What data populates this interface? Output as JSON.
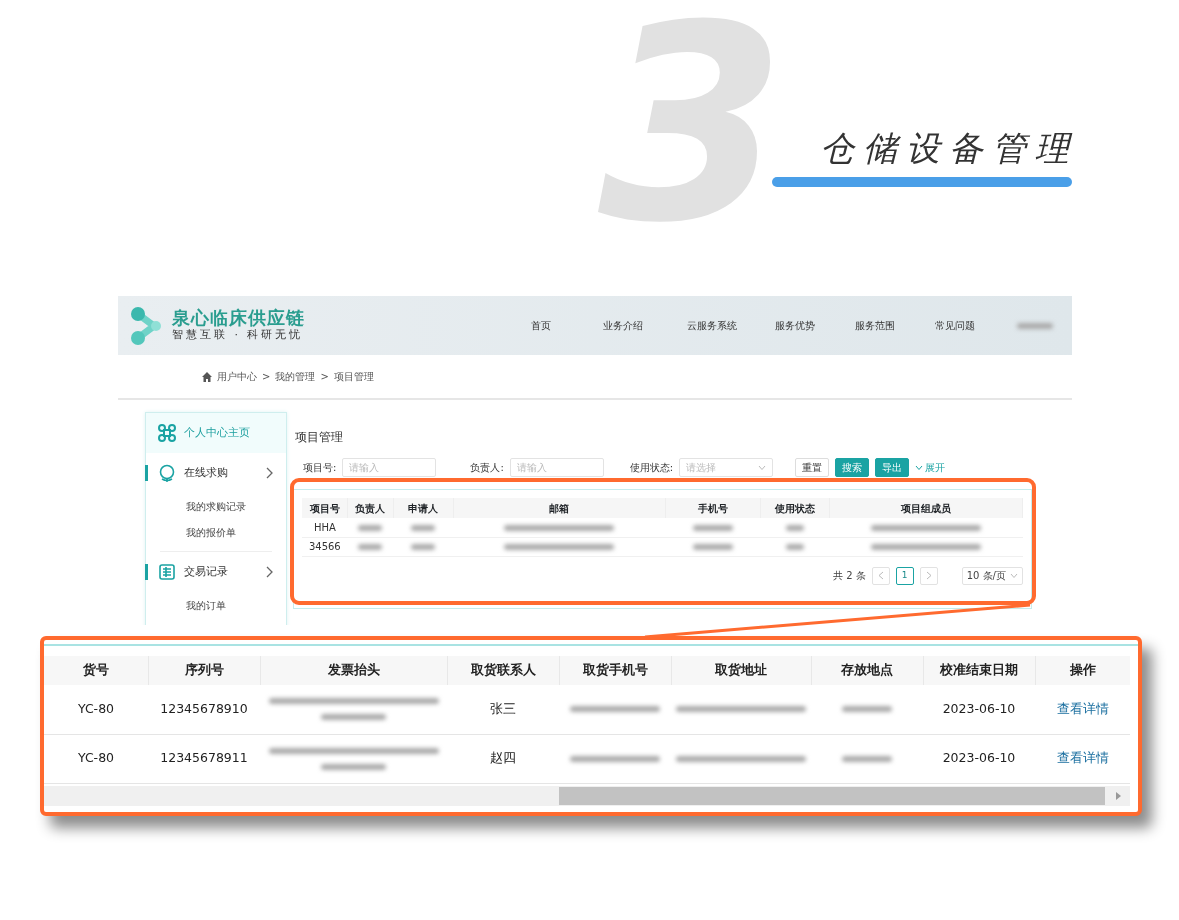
{
  "showcase": {
    "number": "3",
    "title": "仓储设备管理"
  },
  "app": {
    "logo": {
      "name": "泉心临床供应链",
      "slogan": "智慧互联 · 科研无忧"
    },
    "nav": [
      {
        "label": "首页"
      },
      {
        "label": "业务介绍"
      },
      {
        "label": "云服务系统"
      },
      {
        "label": "服务优势"
      },
      {
        "label": "服务范围"
      },
      {
        "label": "常见问题"
      },
      {
        "kind": "redacted"
      }
    ],
    "breadcrumb": [
      "用户中心",
      "我的管理",
      "项目管理"
    ],
    "breadcrumb_separator": ">",
    "sidebar": [
      {
        "label": "个人中心主页",
        "kind": "home",
        "selected": true
      },
      {
        "label": "在线求购",
        "kind": "group",
        "selected": false,
        "children": [
          {
            "label": "我的求购记录",
            "selected": false
          },
          {
            "label": "我的报价单",
            "selected": false
          }
        ]
      },
      {
        "label": "交易记录",
        "kind": "group",
        "selected": false,
        "children": [
          {
            "label": "我的订单",
            "selected": false
          }
        ]
      }
    ],
    "page_title": "项目管理",
    "filters": [
      {
        "label": "项目号:",
        "placeholder": "请输入",
        "kind": "input"
      },
      {
        "label": "负责人:",
        "placeholder": "请输入",
        "kind": "input"
      },
      {
        "label": "使用状态:",
        "placeholder": "请选择",
        "kind": "select"
      }
    ],
    "buttons": [
      {
        "label": "重置",
        "kind": "outline"
      },
      {
        "label": "搜索",
        "kind": "primary"
      },
      {
        "label": "导出",
        "kind": "primary"
      },
      {
        "label": "展开",
        "kind": "link"
      }
    ],
    "table": {
      "columns": [
        "项目号",
        "负责人",
        "申请人",
        "邮箱",
        "手机号",
        "使用状态",
        "项目组成员"
      ],
      "rows": [
        [
          "HHA",
          {
            "kind": "redacted"
          },
          {
            "kind": "redacted"
          },
          {
            "kind": "redacted"
          },
          {
            "kind": "redacted"
          },
          {
            "kind": "redacted"
          },
          {
            "kind": "redacted"
          }
        ],
        [
          "34566",
          {
            "kind": "redacted"
          },
          {
            "kind": "redacted"
          },
          {
            "kind": "redacted"
          },
          {
            "kind": "redacted"
          },
          {
            "kind": "redacted"
          },
          {
            "kind": "redacted"
          }
        ]
      ]
    },
    "pagination": {
      "total": "共 2 条",
      "pages": [
        {
          "label": "1",
          "selected": true
        }
      ],
      "page_size": "10 条/页"
    }
  },
  "zoom_table": {
    "columns": [
      "货号",
      "序列号",
      "发票抬头",
      "取货联系人",
      "取货手机号",
      "取货地址",
      "存放地点",
      "校准结束日期",
      "操作"
    ],
    "rows": [
      [
        "YC-80",
        "12345678910",
        {
          "kind": "redacted-multiline"
        },
        "张三",
        {
          "kind": "redacted"
        },
        {
          "kind": "redacted"
        },
        {
          "kind": "redacted"
        },
        "2023-06-10",
        {
          "kind": "link",
          "text": "查看详情"
        }
      ],
      [
        "YC-80",
        "12345678911",
        {
          "kind": "redacted-multiline"
        },
        "赵四",
        {
          "kind": "redacted"
        },
        {
          "kind": "redacted"
        },
        {
          "kind": "redacted"
        },
        "2023-06-10",
        {
          "kind": "link",
          "text": "查看详情"
        }
      ]
    ]
  }
}
